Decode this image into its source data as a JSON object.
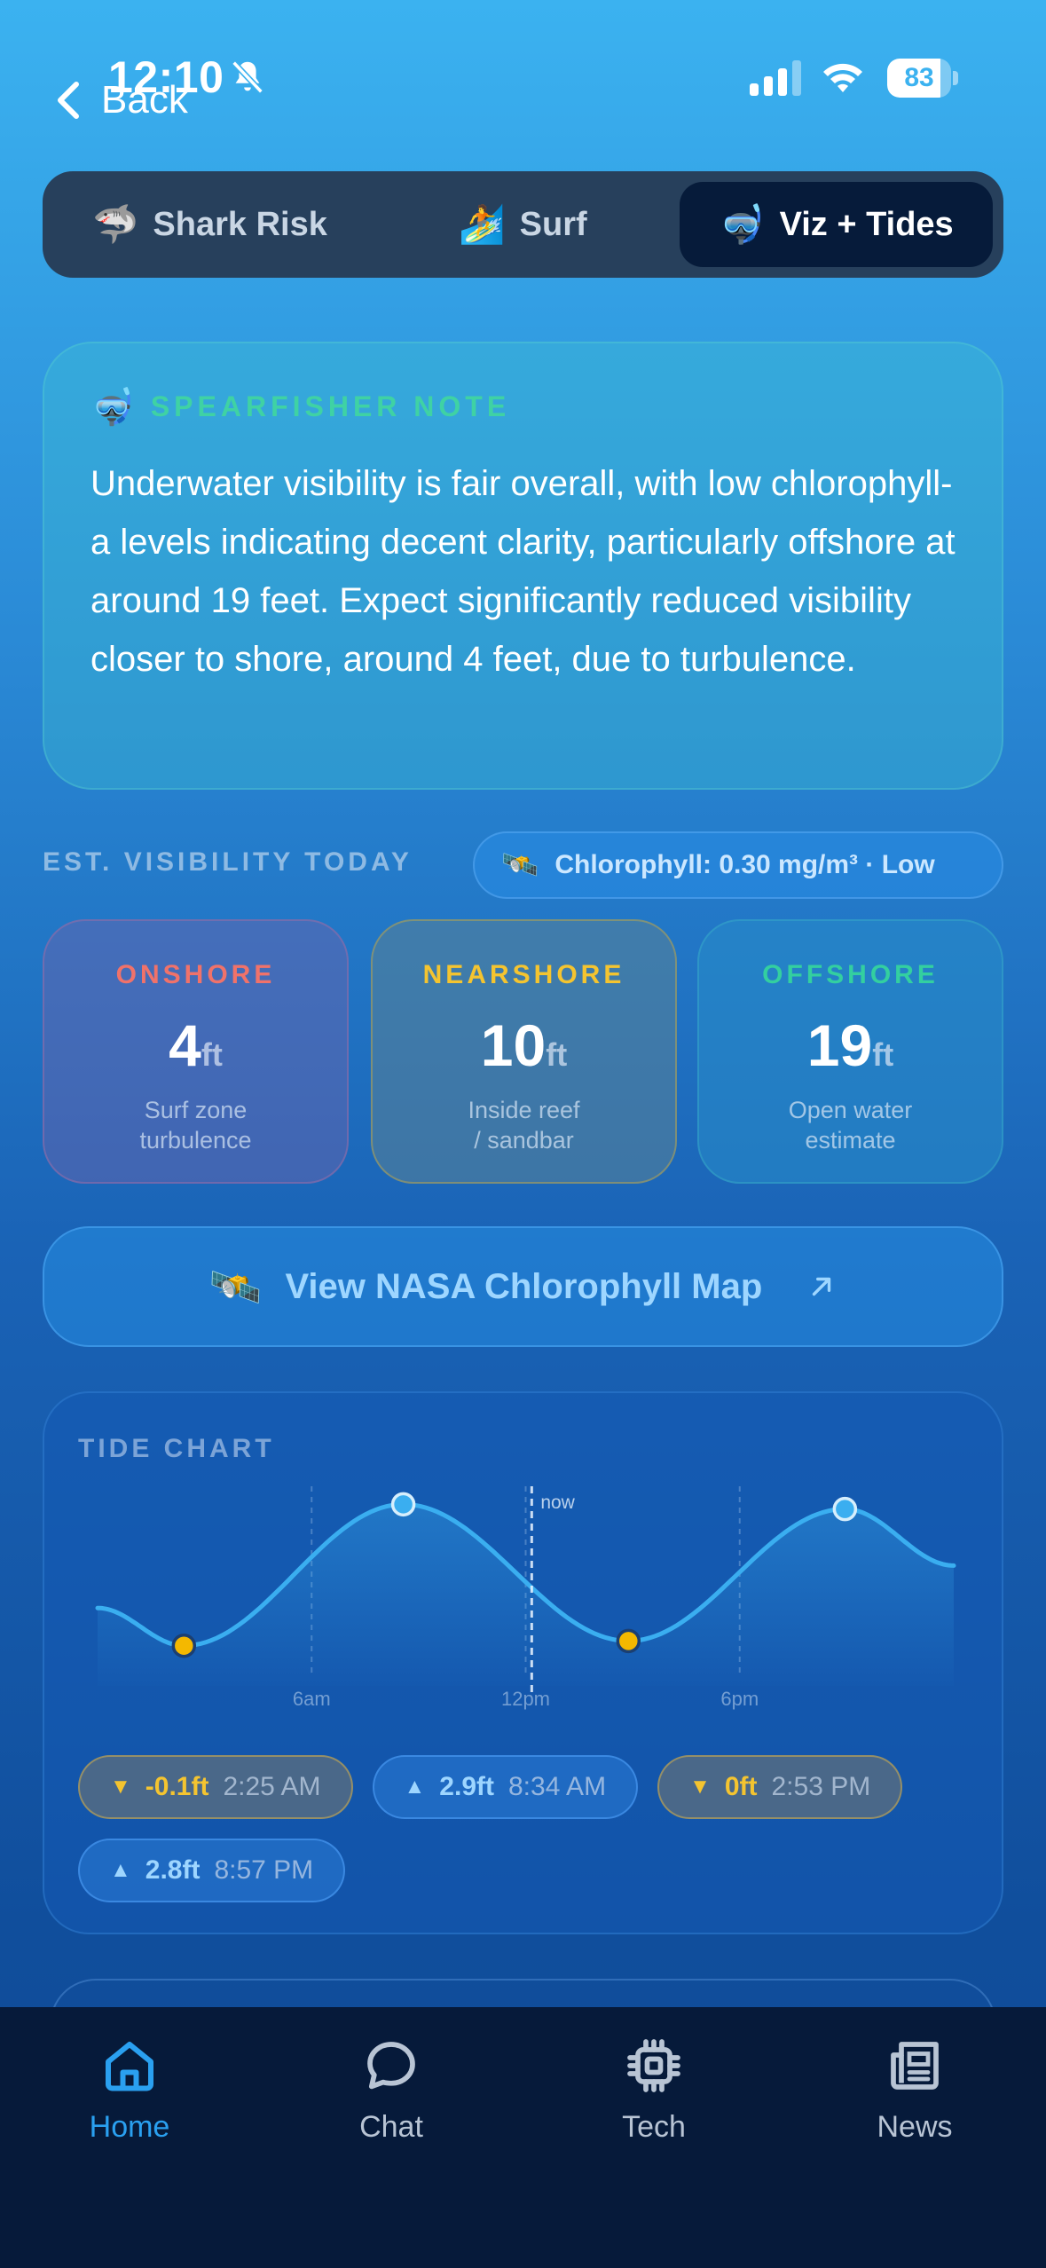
{
  "status_bar": {
    "time": "12:10",
    "battery": "83",
    "battery_level": 0.83
  },
  "header": {
    "back_label": "Back"
  },
  "tabs": [
    {
      "emoji": "🦈",
      "label": "Shark Risk",
      "active": false
    },
    {
      "emoji": "🏄",
      "label": "Surf",
      "active": false
    },
    {
      "emoji": "🤿",
      "label": "Viz + Tides",
      "active": true
    }
  ],
  "note": {
    "emoji": "🤿",
    "title": "SPEARFISHER NOTE",
    "body": "Underwater visibility is fair overall, with low chlorophyll-a levels indicating decent clarity, particularly offshore at around 19 feet. Expect significantly reduced visibility closer to shore, around 4 feet, due to turbulence."
  },
  "visibility": {
    "label": "EST. VISIBILITY TODAY",
    "chlorophyll_emoji": "🛰️",
    "chlorophyll_text": "Chlorophyll: 0.30 mg/m³  ·  Low",
    "cards": {
      "onshore": {
        "zone": "ONSHORE",
        "value": "4",
        "unit": "ft",
        "sub1": "Surf zone",
        "sub2": "turbulence"
      },
      "nearshore": {
        "zone": "NEARSHORE",
        "value": "10",
        "unit": "ft",
        "sub1": "Inside reef",
        "sub2": "/ sandbar"
      },
      "offshore": {
        "zone": "OFFSHORE",
        "value": "19",
        "unit": "ft",
        "sub1": "Open water",
        "sub2": "estimate"
      }
    },
    "colors": {
      "onshore": "#f0726a",
      "nearshore": "#f4c430",
      "offshore": "#33cfa0"
    }
  },
  "nasa": {
    "emoji": "🛰️",
    "label": "View NASA Chlorophyll Map",
    "arrow_icon": "external-arrow-icon"
  },
  "tide": {
    "title": "TIDE CHART",
    "now_label": "now",
    "axis_labels": [
      "6am",
      "12pm",
      "6pm"
    ],
    "extremes": [
      {
        "type": "low",
        "height": "-0.1ft",
        "time": "2:25 AM"
      },
      {
        "type": "high",
        "height": "2.9ft",
        "time": "8:34 AM"
      },
      {
        "type": "low",
        "height": "0ft",
        "time": "2:53 PM"
      },
      {
        "type": "high",
        "height": "2.8ft",
        "time": "8:57 PM"
      }
    ],
    "colors": {
      "line": "#3aaef0",
      "low_marker": "#f4b800",
      "high_marker": "#3aaef0"
    }
  },
  "chart_data": {
    "type": "line",
    "title": "TIDE CHART",
    "xlabel": "",
    "ylabel": "",
    "x_tick_labels": [
      "6am",
      "12pm",
      "6pm"
    ],
    "x_hours": [
      0,
      2.42,
      8.57,
      14.88,
      20.95,
      24
    ],
    "y_ft": [
      0.7,
      -0.1,
      2.9,
      0.0,
      2.8,
      1.6
    ],
    "markers": [
      {
        "x_hour": 2.42,
        "y_ft": -0.1,
        "kind": "low"
      },
      {
        "x_hour": 8.57,
        "y_ft": 2.9,
        "kind": "high"
      },
      {
        "x_hour": 14.88,
        "y_ft": 0.0,
        "kind": "low"
      },
      {
        "x_hour": 20.95,
        "y_ft": 2.8,
        "kind": "high"
      }
    ],
    "now_hour": 12.17,
    "ylim": [
      -0.2,
      3.0
    ],
    "xlim": [
      0,
      24
    ],
    "grid": "vertical dashed at 6am, 12pm, 6pm"
  },
  "bottom_nav": [
    {
      "icon": "home-icon",
      "label": "Home",
      "active": true
    },
    {
      "icon": "chat-icon",
      "label": "Chat",
      "active": false
    },
    {
      "icon": "chip-icon",
      "label": "Tech",
      "active": false
    },
    {
      "icon": "news-icon",
      "label": "News",
      "active": false
    }
  ]
}
